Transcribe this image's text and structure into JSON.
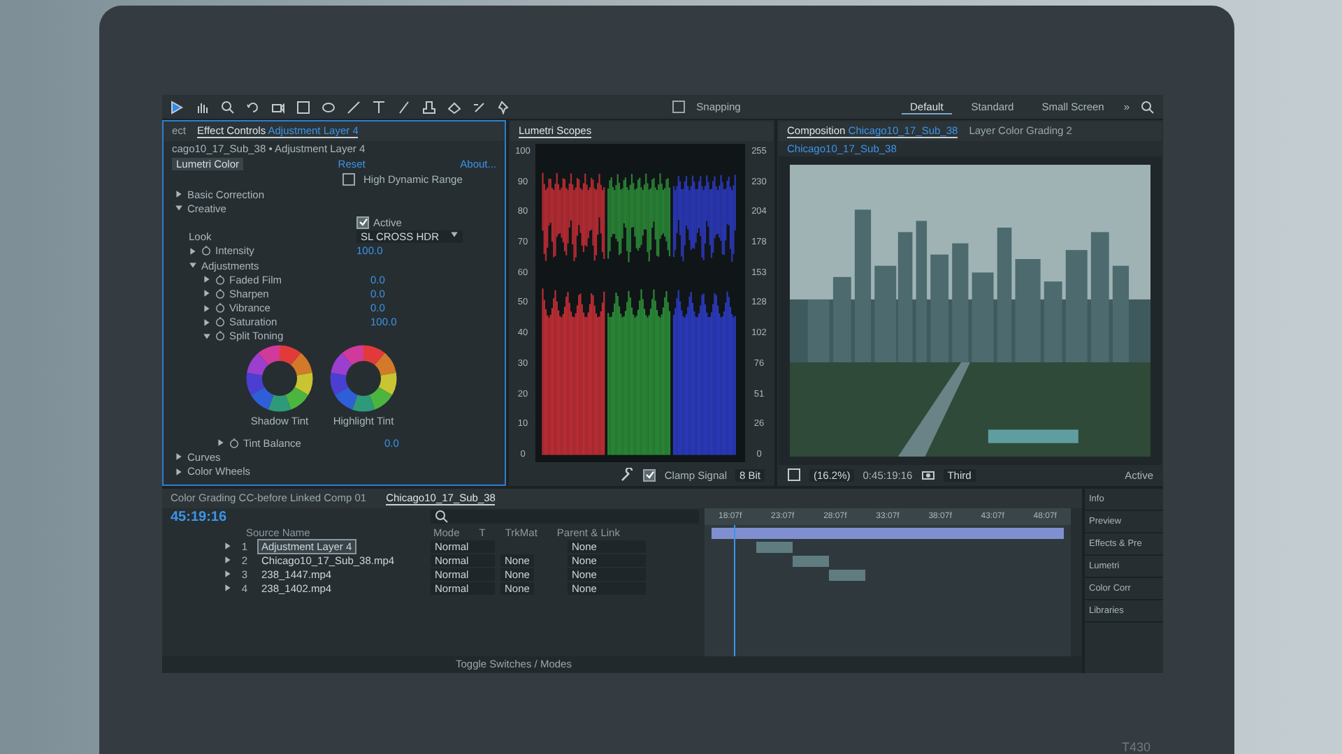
{
  "toolbar": {
    "snapping": {
      "label": "Snapping",
      "checked": false
    },
    "workspaces": [
      {
        "label": "Default",
        "selected": true
      },
      {
        "label": "Standard",
        "selected": false
      },
      {
        "label": "Small Screen",
        "selected": false
      }
    ],
    "overflow": "»"
  },
  "effect_controls": {
    "tabs": [
      {
        "label": "ect",
        "selected": false
      },
      {
        "label": "Effect Controls",
        "layer": "Adjustment Layer 4",
        "selected": true
      }
    ],
    "header": "cago10_17_Sub_38 • Adjustment Layer 4",
    "effect": "Lumetri Color",
    "reset": "Reset",
    "about": "About...",
    "hdr": {
      "label": "High Dynamic Range",
      "checked": false
    },
    "properties": [
      {
        "kind": "section",
        "label": "Basic Correction",
        "expanded": false
      },
      {
        "kind": "section",
        "label": "Creative",
        "expanded": true,
        "children": [
          {
            "kind": "checkbox",
            "label": "Active",
            "checked": true
          },
          {
            "kind": "dropdown",
            "label": "Look",
            "value": "SL CROSS HDR"
          },
          {
            "kind": "param",
            "label": "Intensity",
            "value": "100.0",
            "expanded": false
          },
          {
            "kind": "section",
            "label": "Adjustments",
            "expanded": true,
            "children": [
              {
                "kind": "param",
                "label": "Faded Film",
                "value": "0.0",
                "expanded": false
              },
              {
                "kind": "param",
                "label": "Sharpen",
                "value": "0.0",
                "expanded": false
              },
              {
                "kind": "param",
                "label": "Vibrance",
                "value": "0.0",
                "expanded": false
              },
              {
                "kind": "param",
                "label": "Saturation",
                "value": "100.0",
                "expanded": false
              },
              {
                "kind": "param",
                "label": "Split Toning",
                "expanded": true,
                "children": [
                  {
                    "kind": "wheels",
                    "labels": [
                      "Shadow Tint",
                      "Highlight Tint"
                    ]
                  },
                  {
                    "kind": "param",
                    "label": "Tint Balance",
                    "value": "0.0",
                    "expanded": false
                  }
                ]
              }
            ]
          }
        ]
      },
      {
        "kind": "section",
        "label": "Curves",
        "expanded": false
      },
      {
        "kind": "section",
        "label": "Color Wheels",
        "expanded": false
      }
    ]
  },
  "scopes": {
    "title": "Lumetri Scopes",
    "left_ticks": [
      "100",
      "90",
      "80",
      "70",
      "60",
      "50",
      "40",
      "30",
      "20",
      "10",
      "0"
    ],
    "right_ticks": [
      "255",
      "230",
      "204",
      "178",
      "153",
      "128",
      "102",
      "76",
      "51",
      "26",
      "0"
    ],
    "clamp": {
      "label": "Clamp Signal",
      "checked": true
    },
    "bit_depth": "8 Bit"
  },
  "composition": {
    "tabs": [
      {
        "label": "Composition",
        "comp": "Chicago10_17_Sub_38",
        "selected": true
      },
      {
        "label": "Layer Color Grading 2",
        "selected": false
      }
    ],
    "subtab": "Chicago10_17_Sub_38",
    "zoom": "(16.2%)",
    "timecode": "0:45:19:16",
    "view": "Third",
    "camera": "Active"
  },
  "timeline": {
    "tabs": [
      {
        "label": "Color Grading CC-before Linked Comp 01",
        "selected": false
      },
      {
        "label": "Chicago10_17_Sub_38",
        "selected": true
      }
    ],
    "timecode": "45:19:16",
    "columns": [
      "Source Name",
      "Mode",
      "T",
      "TrkMat",
      "Parent & Link"
    ],
    "layers": [
      {
        "number": "1",
        "name": "Adjustment Layer 4",
        "mode": "Normal",
        "parent": "None",
        "selected": true
      },
      {
        "number": "2",
        "name": "Chicago10_17_Sub_38.mp4",
        "mode": "Normal",
        "trkmat": "None",
        "parent": "None",
        "selected": false
      },
      {
        "number": "3",
        "name": "238_1447.mp4",
        "mode": "Normal",
        "trkmat": "None",
        "parent": "None",
        "selected": false
      },
      {
        "number": "4",
        "name": "238_1402.mp4",
        "mode": "Normal",
        "trkmat": "None",
        "parent": "None",
        "selected": false
      }
    ],
    "ruler": [
      "18:07f",
      "23:07f",
      "28:07f",
      "33:07f",
      "38:07f",
      "43:07f",
      "48:07f"
    ],
    "toggle": "Toggle Switches / Modes"
  },
  "side_panel": {
    "items": [
      "Info",
      "Preview",
      "Effects & Pre",
      "Lumetri",
      "Color Corr",
      "Libraries"
    ]
  },
  "laptop": {
    "model": "T430"
  }
}
